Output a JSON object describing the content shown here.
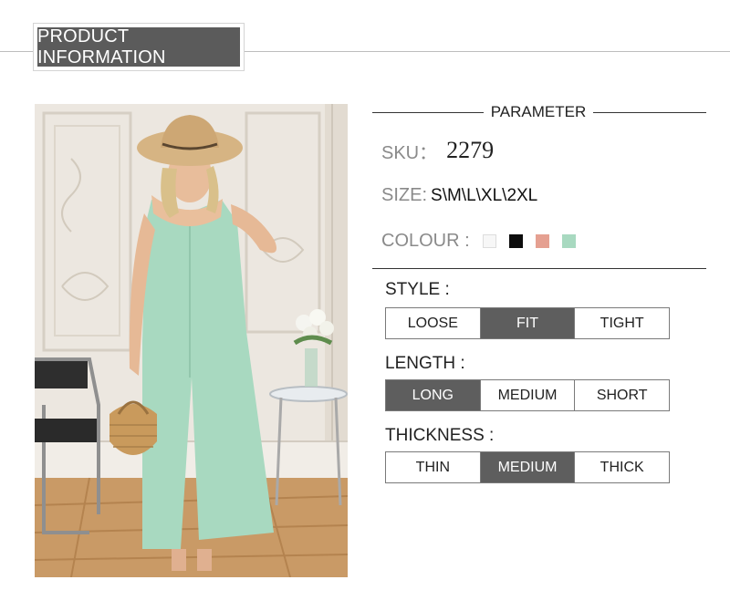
{
  "header": {
    "title": "PRODUCT INFORMATION"
  },
  "parameter": {
    "title": "PARAMETER",
    "sku": {
      "label": "SKU：",
      "value": "2279"
    },
    "size": {
      "label": "SIZE:",
      "value": "S\\M\\L\\XL\\2XL"
    },
    "colour": {
      "label": "COLOUR :",
      "swatches": [
        "#f7f7f7",
        "#0d0d0d",
        "#e5a091",
        "#a8d9c0"
      ]
    }
  },
  "options": {
    "style": {
      "label": "STYLE :",
      "items": [
        "LOOSE",
        "FIT",
        "TIGHT"
      ],
      "selected": "FIT"
    },
    "length": {
      "label": "LENGTH :",
      "items": [
        "LONG",
        "MEDIUM",
        "SHORT"
      ],
      "selected": "LONG"
    },
    "thickness": {
      "label": "THICKNESS :",
      "items": [
        "THIN",
        "MEDIUM",
        "THICK"
      ],
      "selected": "MEDIUM"
    }
  },
  "colors": {
    "selected_bg": "#5e5e5e",
    "header_bg": "#5b5b5b",
    "jumpsuit": "#a8d9c0"
  }
}
